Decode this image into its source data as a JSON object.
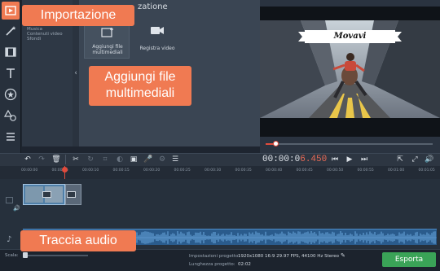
{
  "callouts": {
    "import": "Importazione",
    "add_files_line1": "Aggiungi file",
    "add_files_line2": "multimediali",
    "audio_track": "Traccia audio"
  },
  "panel": {
    "title_partial": "zatione",
    "sub_items": [
      "Musica",
      "Contenuti video",
      "Sfondi"
    ],
    "add_files_label_1": "Aggiungi file",
    "add_files_label_2": "multimediali",
    "record_video_label": "Registra video"
  },
  "preview": {
    "banner_text": "Movavi",
    "time_static": "00:00:0",
    "time_accent": "6.450"
  },
  "ruler_ticks": [
    "00:00:00",
    "00:00:05",
    "00:00:10",
    "00:00:15",
    "00:00:20",
    "00:00:25",
    "00:00:30",
    "00:00:35",
    "00:00:40",
    "00:00:45",
    "00:00:50",
    "00:00:55",
    "00:01:00",
    "00:01:05"
  ],
  "bottom": {
    "scale_label": "Scala:",
    "settings_label": "Impostazioni progetto:",
    "settings_value": "1920x1080 16:9 29.97 FPS, 44100 Hz Stereo",
    "length_label": "Lunghezza progetto:",
    "length_value": "02:02",
    "export_label": "Esporta"
  },
  "colors": {
    "accent": "#f07a52",
    "export_bg": "#3aa357",
    "playhead": "#e04b3c",
    "time_accent": "#e86a55"
  }
}
